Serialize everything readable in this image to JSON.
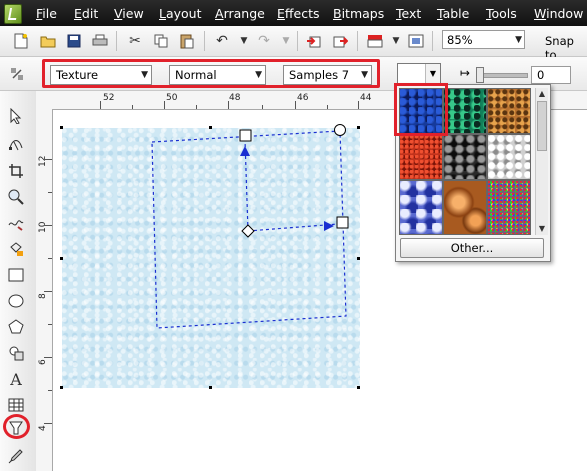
{
  "menu": {
    "items": [
      "File",
      "Edit",
      "View",
      "Layout",
      "Arrange",
      "Effects",
      "Bitmaps",
      "Text",
      "Table",
      "Tools",
      "Window"
    ]
  },
  "standard_toolbar": {
    "zoom_value": "85%",
    "snap_label": "Snap to"
  },
  "property_bar": {
    "fill_type": "Texture",
    "blend_mode": "Normal",
    "library": "Samples 7",
    "smoothness_value": "0"
  },
  "ruler": {
    "top_labels": [
      "52",
      "50",
      "48",
      "46",
      "44"
    ],
    "left_labels": [
      "12",
      "10",
      "8",
      "6",
      "4"
    ]
  },
  "texture_picker": {
    "other_button_label": "Other...",
    "textures": [
      "dark-blue-speckle",
      "green-teal-organic",
      "brown-orange-grain",
      "red-noise",
      "black-gray-blotches",
      "white-gray-stucco",
      "blue-marble",
      "orange-spheres",
      "multicolor-noise"
    ]
  },
  "colors": {
    "highlight_red": "#e1212b",
    "menu_bar": "#1a1a1a",
    "page_fill": "#cfe8f4",
    "vector_handle": "#1a2fd1"
  }
}
